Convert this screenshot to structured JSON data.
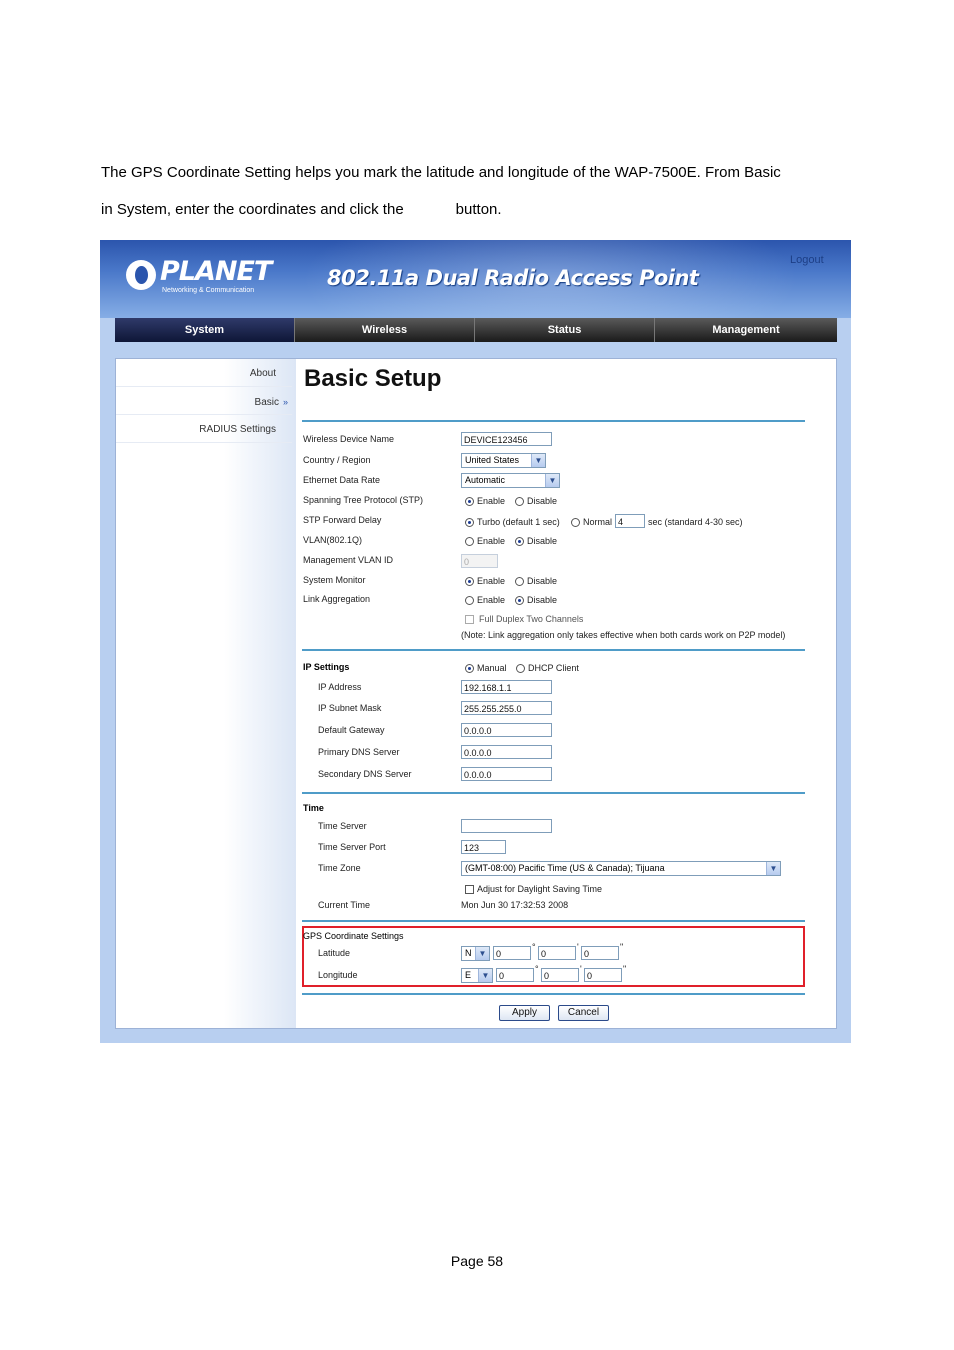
{
  "intro": {
    "line1": "The GPS Coordinate Setting helps you mark the latitude and longitude of the WAP-7500E.    From Basic",
    "line2a": "in System, enter the coordinates and click the",
    "line2b": "button."
  },
  "header": {
    "brand": "PLANET",
    "tagline": "Networking & Communication",
    "product": "802.11a Dual Radio Access Point",
    "logout": "Logout"
  },
  "nav": [
    "System",
    "Wireless",
    "Status",
    "Management"
  ],
  "sidebar": [
    {
      "label": "About"
    },
    {
      "label": "Basic",
      "marker": "»"
    },
    {
      "label": "RADIUS Settings"
    }
  ],
  "page_title": "Basic Setup",
  "general": {
    "device_name_label": "Wireless Device Name",
    "device_name_value": "DEVICE123456",
    "country_label": "Country / Region",
    "country_value": "United States",
    "rate_label": "Ethernet Data Rate",
    "rate_value": "Automatic",
    "stp_label": "Spanning Tree Protocol (STP)",
    "stp_enable": "Enable",
    "stp_disable": "Disable",
    "delay_label": "STP Forward Delay",
    "delay_turbo": "Turbo (default 1 sec)",
    "delay_normal": "Normal",
    "delay_value": "4",
    "delay_hint": "sec (standard 4-30 sec)",
    "vlan_label": "VLAN(802.1Q)",
    "vlan_enable": "Enable",
    "vlan_disable": "Disable",
    "mgmt_vlan_label": "Management VLAN ID",
    "mgmt_vlan_value": "0",
    "monitor_label": "System Monitor",
    "monitor_enable": "Enable",
    "monitor_disable": "Disable",
    "agg_label": "Link Aggregation",
    "agg_enable": "Enable",
    "agg_disable": "Disable",
    "full_duplex": "Full Duplex Two Channels",
    "agg_note": "(Note: Link aggregation only takes effective when both cards work on P2P model)"
  },
  "ip": {
    "section": "IP Settings",
    "manual": "Manual",
    "dhcp": "DHCP Client",
    "addr_label": "IP Address",
    "addr_value": "192.168.1.1",
    "mask_label": "IP Subnet Mask",
    "mask_value": "255.255.255.0",
    "gw_label": "Default Gateway",
    "gw_value": "0.0.0.0",
    "dns1_label": "Primary DNS Server",
    "dns1_value": "0.0.0.0",
    "dns2_label": "Secondary DNS Server",
    "dns2_value": "0.0.0.0"
  },
  "time": {
    "section": "Time",
    "server_label": "Time Server",
    "server_value": "",
    "port_label": "Time Server Port",
    "port_value": "123",
    "zone_label": "Time Zone",
    "zone_value": "(GMT-08:00) Pacific Time (US & Canada); Tijuana",
    "dst": "Adjust for Daylight Saving Time",
    "current_label": "Current Time",
    "current_value": "Mon Jun 30 17:32:53 2008"
  },
  "gps": {
    "section": "GPS Coordinate Settings",
    "lat_label": "Latitude",
    "lat_dir": "N",
    "lat_deg": "0",
    "lat_min": "0",
    "lat_sec": "0",
    "lon_label": "Longitude",
    "lon_dir": "E",
    "lon_deg": "0",
    "lon_min": "0",
    "lon_sec": "0",
    "deg_mark": "°",
    "min_mark": "'",
    "sec_mark": "\""
  },
  "buttons": {
    "apply": "Apply",
    "cancel": "Cancel"
  },
  "footer": "Page 58",
  "colors": {
    "highlight": "#e0202a",
    "rule": "#4f9cc8",
    "banner": "#2b55ad"
  }
}
